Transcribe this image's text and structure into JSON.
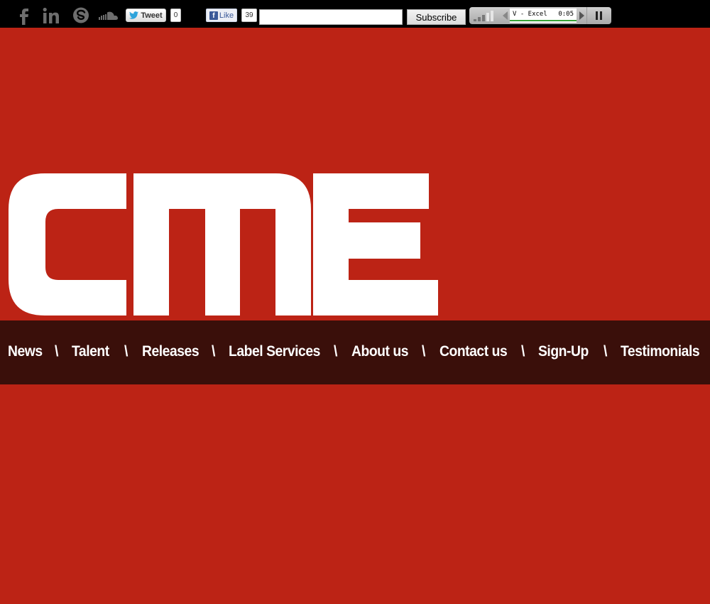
{
  "social": {
    "icons": [
      "facebook-icon",
      "linkedin-icon",
      "skype-icon",
      "soundcloud-icon"
    ]
  },
  "twitter": {
    "label": "Tweet",
    "count": "0"
  },
  "facebook": {
    "label": "Like",
    "count": "39"
  },
  "subscribe": {
    "input_value": "",
    "button_label": "Subscribe"
  },
  "player": {
    "track": "V - Excel",
    "time": "0:05"
  },
  "logo": {
    "text": "CME"
  },
  "nav": {
    "items": [
      "News",
      "Talent",
      "Releases",
      "Label Services",
      "About us",
      "Contact us",
      "Sign-Up",
      "Testimonials"
    ],
    "separator": "\\"
  },
  "colors": {
    "background": "#bc2315",
    "topbar": "#000000",
    "nav_background": "#3a0f0a",
    "logo": "#ffffff",
    "progress": "#39a437"
  }
}
